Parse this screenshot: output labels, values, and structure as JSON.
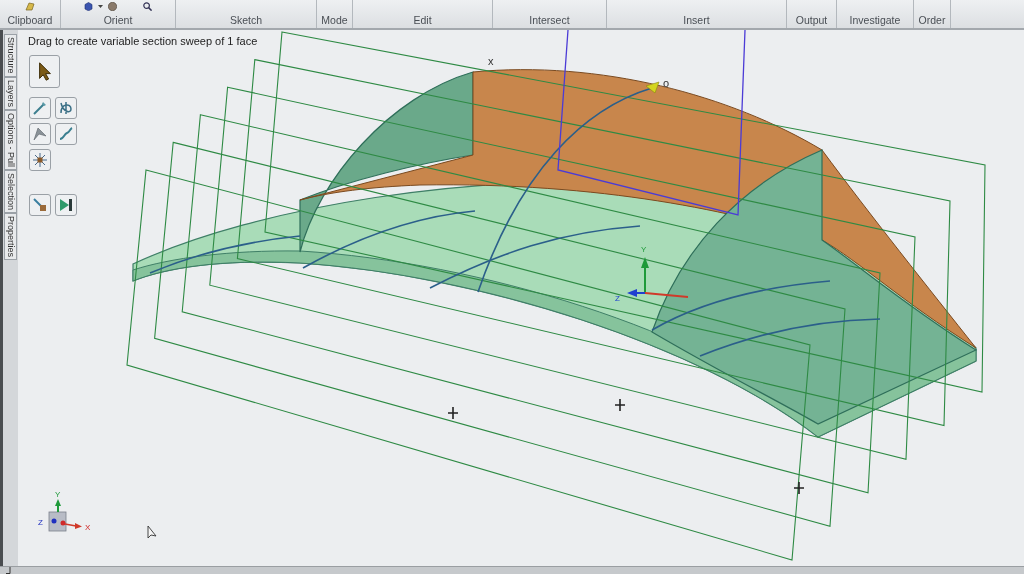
{
  "ribbon": {
    "groups": [
      "Clipboard",
      "Orient",
      "Sketch",
      "Mode",
      "Edit",
      "Intersect",
      "Insert",
      "Output",
      "Investigate",
      "Order"
    ]
  },
  "side_tabs": [
    "Structure",
    "Layers",
    "Options - Pull",
    "Selection",
    "Properties"
  ],
  "viewport": {
    "prompt": "Drag to create variable section sweep of 1 face",
    "vertex_labels": [
      "x",
      "o"
    ],
    "move_triad": {
      "y": "Y",
      "z": "Z"
    },
    "view_triad": {
      "y": "Y",
      "z": "Z",
      "x": "X"
    }
  }
}
